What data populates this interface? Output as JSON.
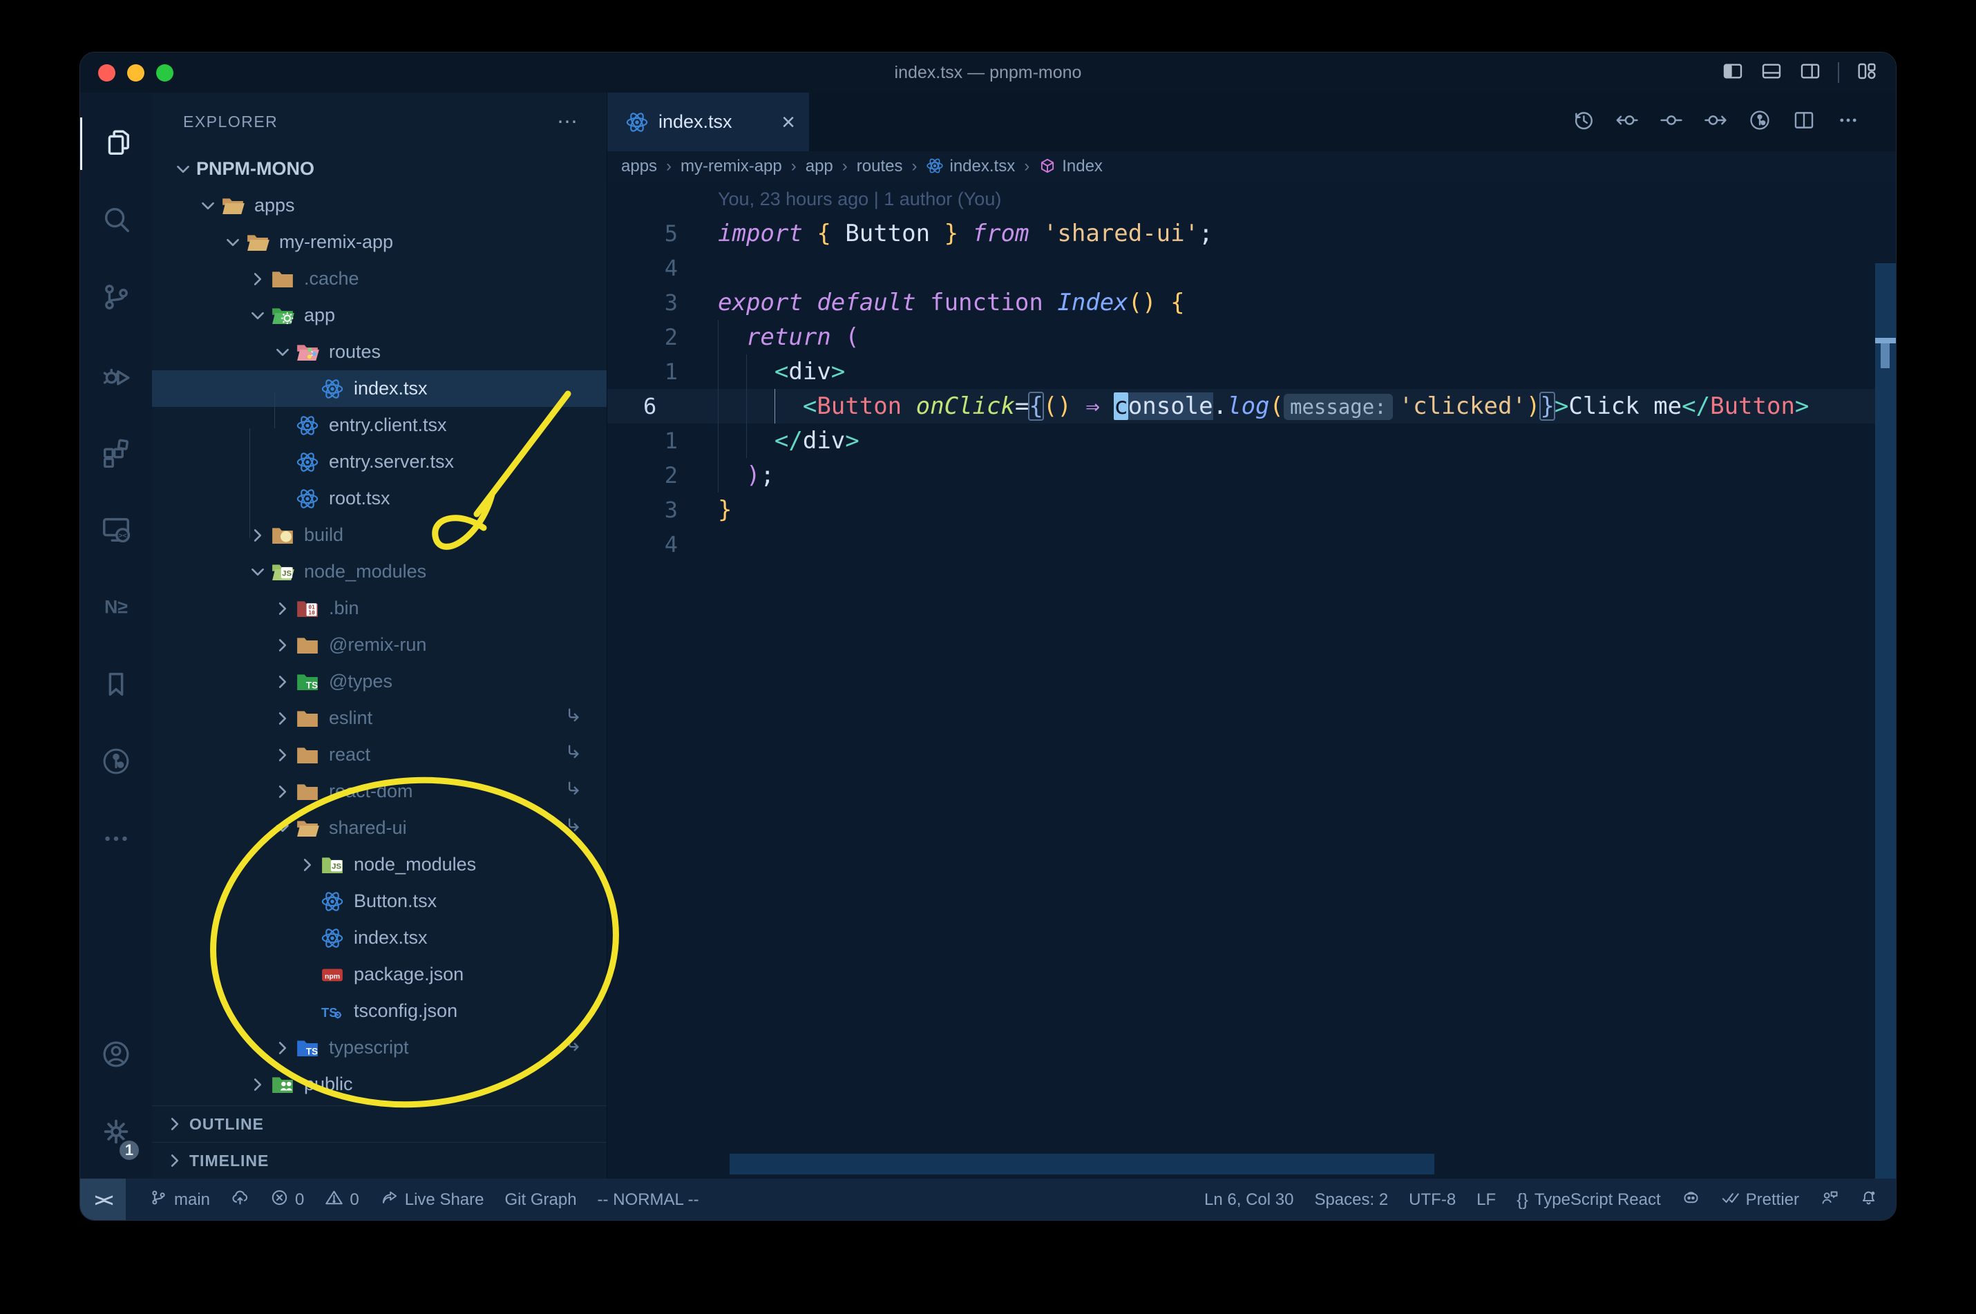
{
  "window": {
    "title": "index.tsx — pnpm-mono"
  },
  "title_bar": {
    "layout_icons": [
      "layout-sidebar-left",
      "layout-panel",
      "layout-sidebar-right",
      "layout-grid"
    ]
  },
  "activity_bar": {
    "top": [
      {
        "name": "explorer",
        "active": true
      },
      {
        "name": "search"
      },
      {
        "name": "source-control"
      },
      {
        "name": "run-debug"
      },
      {
        "name": "extensions"
      },
      {
        "name": "remote-explorer"
      },
      {
        "name": "nx-console"
      },
      {
        "name": "bookmarks"
      },
      {
        "name": "git-graph"
      },
      {
        "name": "more-ellipsis"
      }
    ],
    "bottom": [
      {
        "name": "account"
      },
      {
        "name": "settings",
        "badge": "1"
      }
    ]
  },
  "sidebar": {
    "header": "EXPLORER",
    "header_more": "⋯",
    "root": "PNPM-MONO",
    "tree": [
      {
        "label": "apps",
        "level": 1,
        "type": "folder",
        "open": true,
        "color": "tan"
      },
      {
        "label": "my-remix-app",
        "level": 2,
        "type": "folder",
        "open": true,
        "color": "tan"
      },
      {
        "label": ".cache",
        "level": 3,
        "type": "folder",
        "open": false,
        "color": "tan",
        "dim": true
      },
      {
        "label": "app",
        "level": 3,
        "type": "folder",
        "open": true,
        "color": "green",
        "badge": "gear"
      },
      {
        "label": "routes",
        "level": 4,
        "type": "folder",
        "open": true,
        "color": "pink",
        "badge": "dots"
      },
      {
        "label": "index.tsx",
        "level": 5,
        "type": "file",
        "icon": "react",
        "selected": true
      },
      {
        "label": "entry.client.tsx",
        "level": 4,
        "type": "file",
        "icon": "react"
      },
      {
        "label": "entry.server.tsx",
        "level": 4,
        "type": "file",
        "icon": "react"
      },
      {
        "label": "root.tsx",
        "level": 4,
        "type": "file",
        "icon": "react"
      },
      {
        "label": "build",
        "level": 3,
        "type": "folder",
        "open": false,
        "color": "tan",
        "badge": "dist",
        "dim": true
      },
      {
        "label": "node_modules",
        "level": 3,
        "type": "folder",
        "open": true,
        "color": "lime",
        "badge": "js",
        "dim": true
      },
      {
        "label": ".bin",
        "level": 4,
        "type": "folder",
        "open": false,
        "color": "maroon",
        "badge": "bin",
        "dim": true
      },
      {
        "label": "@remix-run",
        "level": 4,
        "type": "folder",
        "open": false,
        "color": "tan",
        "dim": true
      },
      {
        "label": "@types",
        "level": 4,
        "type": "folder",
        "open": false,
        "color": "green2",
        "badge": "ts",
        "dim": true
      },
      {
        "label": "eslint",
        "level": 4,
        "type": "folder",
        "open": false,
        "color": "tan",
        "dim": true,
        "symlink": true
      },
      {
        "label": "react",
        "level": 4,
        "type": "folder",
        "open": false,
        "color": "tan",
        "dim": true,
        "symlink": true
      },
      {
        "label": "react-dom",
        "level": 4,
        "type": "folder",
        "open": false,
        "color": "tan",
        "dim": true,
        "symlink": true
      },
      {
        "label": "shared-ui",
        "level": 4,
        "type": "folder",
        "open": true,
        "color": "tan",
        "dim": true,
        "symlink": true
      },
      {
        "label": "node_modules",
        "level": 5,
        "type": "folder",
        "open": false,
        "color": "lime",
        "badge": "js"
      },
      {
        "label": "Button.tsx",
        "level": 5,
        "type": "file",
        "icon": "react"
      },
      {
        "label": "index.tsx",
        "level": 5,
        "type": "file",
        "icon": "react"
      },
      {
        "label": "package.json",
        "level": 5,
        "type": "file",
        "icon": "npm"
      },
      {
        "label": "tsconfig.json",
        "level": 5,
        "type": "file",
        "icon": "tsconfig"
      },
      {
        "label": "typescript",
        "level": 4,
        "type": "folder",
        "open": false,
        "color": "blue",
        "badge": "ts",
        "dim": true,
        "symlink": true
      },
      {
        "label": "public",
        "level": 3,
        "type": "folder",
        "open": false,
        "color": "green3",
        "badge": "people"
      }
    ],
    "sections": [
      "OUTLINE",
      "TIMELINE"
    ]
  },
  "tab": {
    "label": "index.tsx",
    "icon": "react",
    "close": "×"
  },
  "editor_actions": [
    "history",
    "compare-previous",
    "compare-current",
    "compare-next",
    "git-graph",
    "split-editor",
    "more-ellipsis"
  ],
  "breadcrumbs": [
    {
      "label": "apps"
    },
    {
      "label": "my-remix-app"
    },
    {
      "label": "app"
    },
    {
      "label": "routes"
    },
    {
      "label": "index.tsx",
      "icon": "react"
    },
    {
      "label": "Index",
      "icon": "symbol-cube"
    }
  ],
  "editor": {
    "blame": "You, 23 hours ago | 1 author (You)",
    "lines": [
      {
        "num": "5",
        "tokens": [
          [
            "kw",
            "import"
          ],
          [
            "w",
            " "
          ],
          [
            "y",
            "{"
          ],
          [
            "w",
            " Button "
          ],
          [
            "y",
            "}"
          ],
          [
            "w",
            " "
          ],
          [
            "kw",
            "from"
          ],
          [
            "w",
            " "
          ],
          [
            "s",
            "'shared-ui'"
          ],
          [
            "w",
            ";"
          ]
        ]
      },
      {
        "num": "4",
        "tokens": []
      },
      {
        "num": "3",
        "tokens": [
          [
            "kw",
            "export"
          ],
          [
            "w",
            " "
          ],
          [
            "kw",
            "default"
          ],
          [
            "w",
            " "
          ],
          [
            "kwu",
            "function"
          ],
          [
            "w",
            " "
          ],
          [
            "fn",
            "Index"
          ],
          [
            "y",
            "()"
          ],
          [
            "w",
            " "
          ],
          [
            "y",
            "{"
          ]
        ]
      },
      {
        "num": "2",
        "tokens": [
          [
            "w",
            "  "
          ],
          [
            "kw",
            "return"
          ],
          [
            "w",
            " "
          ],
          [
            "m",
            "("
          ]
        ]
      },
      {
        "num": "1",
        "tokens": [
          [
            "w",
            "    "
          ],
          [
            "t",
            "<"
          ],
          [
            "w",
            "div"
          ],
          [
            "t",
            ">"
          ]
        ]
      },
      {
        "num": "6",
        "cur": true,
        "tokens": [
          [
            "w",
            "      "
          ],
          [
            "t",
            "<"
          ],
          [
            "tag",
            "Button"
          ],
          [
            "w",
            " "
          ],
          [
            "attr",
            "onClick"
          ],
          [
            "w",
            "="
          ],
          [
            "box",
            "{"
          ],
          [
            "y",
            "()"
          ],
          [
            "w",
            " "
          ],
          [
            "m",
            "⇒"
          ],
          [
            "w",
            " "
          ],
          [
            "cur",
            "c"
          ],
          [
            "hl",
            "onsole"
          ],
          [
            "w",
            "."
          ],
          [
            "fn",
            "log"
          ],
          [
            "y",
            "("
          ],
          [
            "inlay",
            "message:"
          ],
          [
            "s",
            "'clicked'"
          ],
          [
            "y",
            ")"
          ],
          [
            "box",
            "}"
          ],
          [
            "t",
            ">"
          ],
          [
            "w",
            "Click me"
          ],
          [
            "t",
            "</"
          ],
          [
            "tag",
            "Button"
          ],
          [
            "t",
            ">"
          ]
        ]
      },
      {
        "num": "1",
        "tokens": [
          [
            "w",
            "    "
          ],
          [
            "t",
            "</"
          ],
          [
            "w",
            "div"
          ],
          [
            "t",
            ">"
          ]
        ]
      },
      {
        "num": "2",
        "tokens": [
          [
            "w",
            "  "
          ],
          [
            "m",
            ")"
          ],
          [
            "w",
            ";"
          ]
        ]
      },
      {
        "num": "3",
        "tokens": [
          [
            "y",
            "}"
          ]
        ]
      },
      {
        "num": "4",
        "tokens": []
      }
    ]
  },
  "status_bar": {
    "left": [
      {
        "icon": "remote-indicator",
        "label": "><"
      },
      {
        "icon": "git-branch",
        "label": "main"
      },
      {
        "icon": "cloud-upload"
      },
      {
        "icon": "error-circle",
        "label": "0"
      },
      {
        "icon": "warning-triangle",
        "label": "0"
      },
      {
        "icon": "live-share",
        "label": "Live Share"
      },
      {
        "label": "Git Graph"
      },
      {
        "label": "-- NORMAL --"
      }
    ],
    "right": [
      {
        "label": "Ln 6, Col 30"
      },
      {
        "label": "Spaces: 2"
      },
      {
        "label": "UTF-8"
      },
      {
        "label": "LF"
      },
      {
        "icon": "braces",
        "label": "TypeScript React"
      },
      {
        "icon": "copilot"
      },
      {
        "icon": "double-check",
        "label": "Prettier"
      },
      {
        "icon": "feedback"
      },
      {
        "icon": "bell-dot"
      }
    ]
  },
  "annotation": {
    "color": "#f2e32a",
    "arrow_points_to": "node_modules",
    "circle_around": "shared-ui package contents"
  }
}
